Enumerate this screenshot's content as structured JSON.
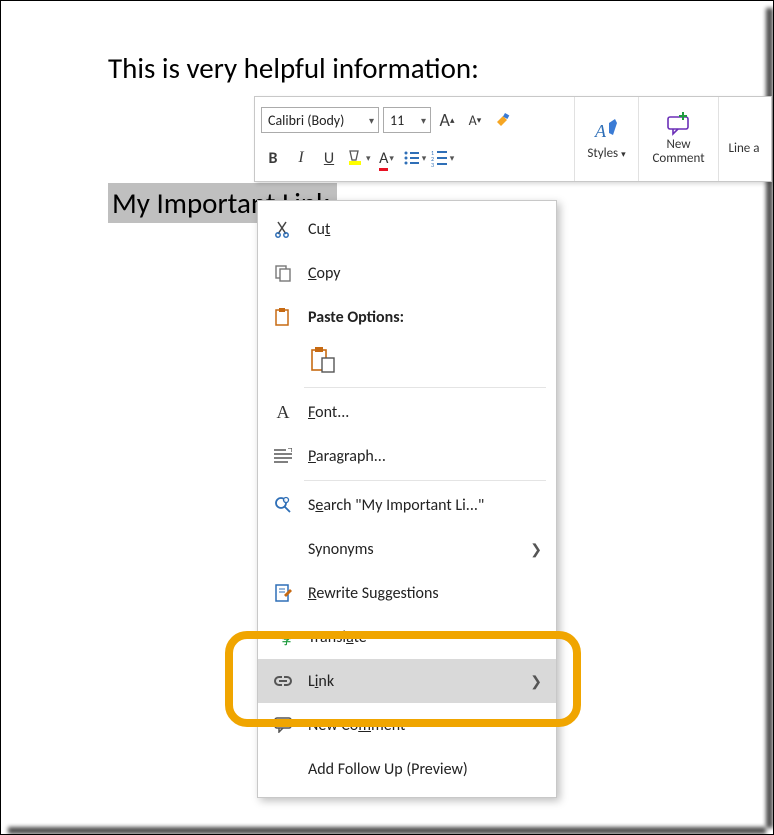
{
  "document": {
    "intro_text": "This is very helpful information:",
    "selected_text": "My Important Link"
  },
  "toolbar": {
    "font_name": "Calibri (Body)",
    "font_size": "11",
    "styles_label": "Styles",
    "new_comment_line1": "New",
    "new_comment_line2": "Comment",
    "line_a_label": "Line a"
  },
  "menu": {
    "cut": "Cut",
    "copy": "Copy",
    "paste_options": "Paste Options:",
    "font": "Font...",
    "paragraph": "Paragraph...",
    "search": "Search \"My Important Li...\"",
    "synonyms": "Synonyms",
    "rewrite": "Rewrite Suggestions",
    "translate": "Translate",
    "link": "Link",
    "new_comment": "New Comment",
    "follow_up": "Add Follow Up (Preview)"
  }
}
